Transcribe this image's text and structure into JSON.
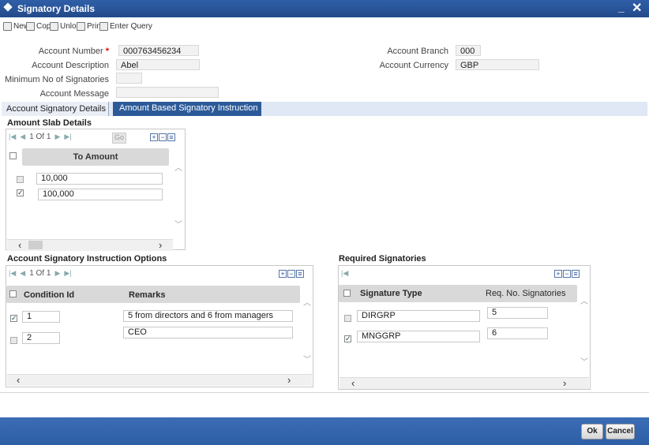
{
  "window": {
    "title": "Signatory Details"
  },
  "toolbar": {
    "new": "New",
    "copy": "Copy",
    "unlock": "Unlock",
    "print": "Print",
    "enter_query": "Enter Query"
  },
  "form": {
    "account_number_label": "Account Number",
    "required_mark": "*",
    "account_number": "000763456234",
    "account_description_label": "Account Description",
    "account_description": "Abel",
    "min_signatories_label": "Minimum No of Signatories",
    "min_signatories": "",
    "account_message_label": "Account Message",
    "account_message": "",
    "account_branch_label": "Account Branch",
    "account_branch": "000",
    "account_currency_label": "Account Currency",
    "account_currency": "GBP"
  },
  "tabs": [
    "Account Signatory Details",
    "Amount Based Signatory Instruction"
  ],
  "amount_slab": {
    "title": "Amount Slab Details",
    "pager": "1 Of 1",
    "go": "Go",
    "column": "To Amount",
    "rows": [
      {
        "amount": "10,000",
        "checked": false
      },
      {
        "amount": "100,000",
        "checked": true
      }
    ]
  },
  "instruction_options": {
    "title": "Account Signatory Instruction Options",
    "pager": "1 Of 1",
    "columns": [
      "Condition Id",
      "Remarks"
    ],
    "rows": [
      {
        "condition_id": "1",
        "remarks": "5 from directors and 6 from managers",
        "checked": true
      },
      {
        "condition_id": "2",
        "remarks": "CEO",
        "checked": false
      }
    ]
  },
  "required_signatories": {
    "title": "Required Signatories",
    "columns": [
      "Signature Type",
      "Req. No. Signatories"
    ],
    "rows": [
      {
        "type": "DIRGRP",
        "count": "5",
        "checked": false
      },
      {
        "type": "MNGGRP",
        "count": "6",
        "checked": true
      }
    ]
  },
  "buttons": {
    "ok": "Ok",
    "cancel": "Cancel"
  },
  "colors": {
    "title_bar": "#2f5fa8",
    "active_tab": "#2c5a99",
    "footer": "#3b6cb5"
  }
}
